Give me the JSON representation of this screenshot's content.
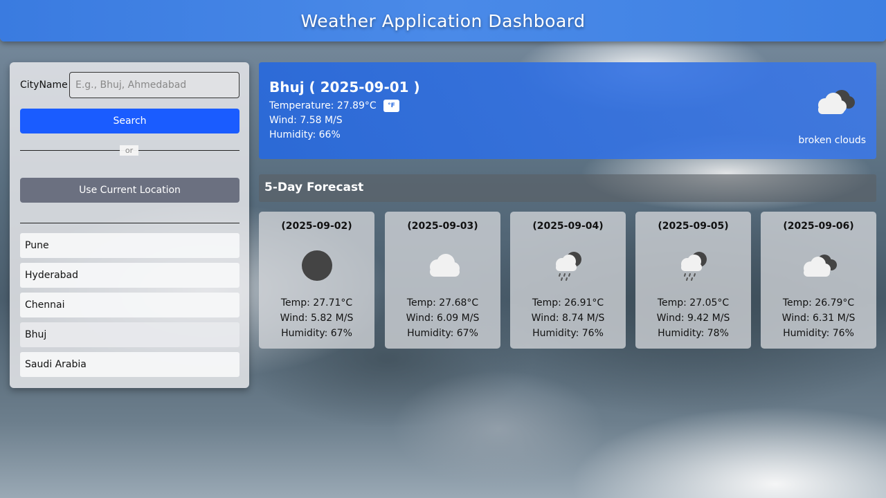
{
  "header": {
    "title": "Weather Application Dashboard"
  },
  "search": {
    "label": "CityName",
    "placeholder": "E.g., Bhuj, Ahmedabad",
    "button_label": "Search",
    "or_text": "or",
    "location_button_label": "Use Current Location"
  },
  "history": [
    "Pune",
    "Hyderabad",
    "Chennai",
    "Bhuj",
    "Saudi Arabia"
  ],
  "current": {
    "title": "Bhuj ( 2025-09-01 )",
    "temperature": "Temperature: 27.89°C",
    "unit_toggle": "°F",
    "wind": "Wind: 7.58 M/S",
    "humidity": "Humidity: 66%",
    "description": "broken clouds",
    "icon": "broken-clouds-icon"
  },
  "forecast": {
    "title": "5-Day Forecast",
    "days": [
      {
        "date": "(2025-09-02)",
        "icon": "overcast-icon",
        "temp": "Temp: 27.71°C",
        "wind": "Wind: 5.82 M/S",
        "humidity": "Humidity: 67%"
      },
      {
        "date": "(2025-09-03)",
        "icon": "cloud-icon",
        "temp": "Temp: 27.68°C",
        "wind": "Wind: 6.09 M/S",
        "humidity": "Humidity: 67%"
      },
      {
        "date": "(2025-09-04)",
        "icon": "rain-cloud-icon",
        "temp": "Temp: 26.91°C",
        "wind": "Wind: 8.74 M/S",
        "humidity": "Humidity: 76%"
      },
      {
        "date": "(2025-09-05)",
        "icon": "rain-cloud-icon",
        "temp": "Temp: 27.05°C",
        "wind": "Wind: 9.42 M/S",
        "humidity": "Humidity: 78%"
      },
      {
        "date": "(2025-09-06)",
        "icon": "broken-clouds-icon",
        "temp": "Temp: 26.79°C",
        "wind": "Wind: 6.31 M/S",
        "humidity": "Humidity: 76%"
      }
    ]
  },
  "colors": {
    "header": "#3a7be0",
    "search_button": "#1a5cff",
    "location_button": "#6b7080",
    "current_card": "#2869dc"
  }
}
